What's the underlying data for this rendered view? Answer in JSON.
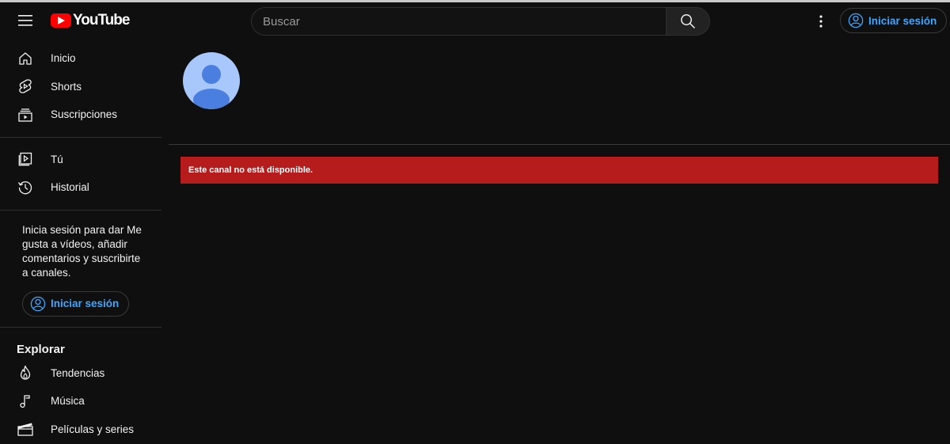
{
  "header": {
    "logo_text": "YouTube",
    "search": {
      "placeholder": "Buscar",
      "value": ""
    },
    "signin_label": "Iniciar sesión"
  },
  "sidebar": {
    "primary": [
      {
        "label": "Inicio",
        "icon": "home-icon"
      },
      {
        "label": "Shorts",
        "icon": "shorts-icon"
      },
      {
        "label": "Suscripciones",
        "icon": "subscriptions-icon"
      }
    ],
    "you": [
      {
        "label": "Tú",
        "icon": "you-icon"
      },
      {
        "label": "Historial",
        "icon": "history-icon"
      }
    ],
    "signin_prompt": "Inicia sesión para dar Me gusta a vídeos, añadir comentarios y suscribirte a canales.",
    "signin_label": "Iniciar sesión",
    "explore": {
      "title": "Explorar",
      "items": [
        {
          "label": "Tendencias",
          "icon": "trending-icon"
        },
        {
          "label": "Música",
          "icon": "music-icon"
        },
        {
          "label": "Películas y series",
          "icon": "movies-icon"
        }
      ]
    }
  },
  "main": {
    "alert_text": "Este canal no está disponible."
  },
  "colors": {
    "background": "#0f0f0f",
    "alert": "#b71c1c",
    "link_blue": "#3ea6ff",
    "avatar": "#a8c7fa",
    "avatar_figure": "#4a7fe0",
    "logo_red": "#ff0000"
  }
}
